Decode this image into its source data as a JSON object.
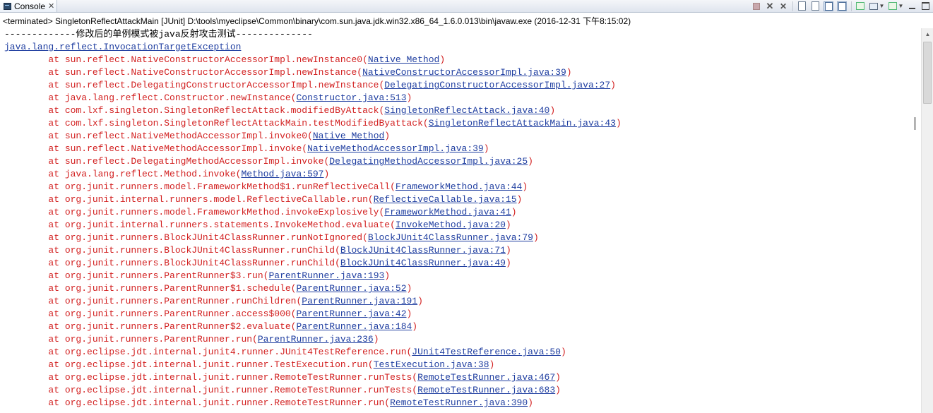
{
  "tab": {
    "label": "Console",
    "icon": "console-icon",
    "close": "✕"
  },
  "toolbar": {
    "icons": [
      "terminate-icon",
      "remove-launch-icon",
      "remove-all-terminated-icon",
      "clear-console-icon",
      "scroll-lock-icon",
      "word-wrap-icon",
      "show-console-on-output-icon",
      "pin-console-icon",
      "display-selected-console-icon",
      "open-console-icon",
      "minimize-icon",
      "maximize-icon"
    ]
  },
  "status_text": "<terminated> SingletonReflectAttackMain [JUnit] D:\\tools\\myeclipse\\Common\\binary\\com.sun.java.jdk.win32.x86_64_1.6.0.013\\bin\\javaw.exe (2016-12-31 下午8:15:02)",
  "output": {
    "separator": "-------------修改后的单例模式被java反射攻击测试--------------",
    "exception": "java.lang.reflect.InvocationTargetException",
    "frames": [
      {
        "pre": "\tat sun.reflect.NativeConstructorAccessorImpl.newInstance0(",
        "loc": "Native Method",
        "post": ")"
      },
      {
        "pre": "\tat sun.reflect.NativeConstructorAccessorImpl.newInstance(",
        "loc": "NativeConstructorAccessorImpl.java:39",
        "post": ")"
      },
      {
        "pre": "\tat sun.reflect.DelegatingConstructorAccessorImpl.newInstance(",
        "loc": "DelegatingConstructorAccessorImpl.java:27",
        "post": ")"
      },
      {
        "pre": "\tat java.lang.reflect.Constructor.newInstance(",
        "loc": "Constructor.java:513",
        "post": ")"
      },
      {
        "pre": "\tat com.lxf.singleton.SingletonReflectAttack.modifiedByAttack(",
        "loc": "SingletonReflectAttack.java:40",
        "post": ")"
      },
      {
        "pre": "\tat com.lxf.singleton.SingletonReflectAttackMain.testModifiedByattack(",
        "loc": "SingletonReflectAttackMain.java:43",
        "post": ")"
      },
      {
        "pre": "\tat sun.reflect.NativeMethodAccessorImpl.invoke0(",
        "loc": "Native Method",
        "post": ")"
      },
      {
        "pre": "\tat sun.reflect.NativeMethodAccessorImpl.invoke(",
        "loc": "NativeMethodAccessorImpl.java:39",
        "post": ")"
      },
      {
        "pre": "\tat sun.reflect.DelegatingMethodAccessorImpl.invoke(",
        "loc": "DelegatingMethodAccessorImpl.java:25",
        "post": ")"
      },
      {
        "pre": "\tat java.lang.reflect.Method.invoke(",
        "loc": "Method.java:597",
        "post": ")"
      },
      {
        "pre": "\tat org.junit.runners.model.FrameworkMethod$1.runReflectiveCall(",
        "loc": "FrameworkMethod.java:44",
        "post": ")"
      },
      {
        "pre": "\tat org.junit.internal.runners.model.ReflectiveCallable.run(",
        "loc": "ReflectiveCallable.java:15",
        "post": ")"
      },
      {
        "pre": "\tat org.junit.runners.model.FrameworkMethod.invokeExplosively(",
        "loc": "FrameworkMethod.java:41",
        "post": ")"
      },
      {
        "pre": "\tat org.junit.internal.runners.statements.InvokeMethod.evaluate(",
        "loc": "InvokeMethod.java:20",
        "post": ")"
      },
      {
        "pre": "\tat org.junit.runners.BlockJUnit4ClassRunner.runNotIgnored(",
        "loc": "BlockJUnit4ClassRunner.java:79",
        "post": ")"
      },
      {
        "pre": "\tat org.junit.runners.BlockJUnit4ClassRunner.runChild(",
        "loc": "BlockJUnit4ClassRunner.java:71",
        "post": ")"
      },
      {
        "pre": "\tat org.junit.runners.BlockJUnit4ClassRunner.runChild(",
        "loc": "BlockJUnit4ClassRunner.java:49",
        "post": ")"
      },
      {
        "pre": "\tat org.junit.runners.ParentRunner$3.run(",
        "loc": "ParentRunner.java:193",
        "post": ")"
      },
      {
        "pre": "\tat org.junit.runners.ParentRunner$1.schedule(",
        "loc": "ParentRunner.java:52",
        "post": ")"
      },
      {
        "pre": "\tat org.junit.runners.ParentRunner.runChildren(",
        "loc": "ParentRunner.java:191",
        "post": ")"
      },
      {
        "pre": "\tat org.junit.runners.ParentRunner.access$000(",
        "loc": "ParentRunner.java:42",
        "post": ")"
      },
      {
        "pre": "\tat org.junit.runners.ParentRunner$2.evaluate(",
        "loc": "ParentRunner.java:184",
        "post": ")"
      },
      {
        "pre": "\tat org.junit.runners.ParentRunner.run(",
        "loc": "ParentRunner.java:236",
        "post": ")"
      },
      {
        "pre": "\tat org.eclipse.jdt.internal.junit4.runner.JUnit4TestReference.run(",
        "loc": "JUnit4TestReference.java:50",
        "post": ")"
      },
      {
        "pre": "\tat org.eclipse.jdt.internal.junit.runner.TestExecution.run(",
        "loc": "TestExecution.java:38",
        "post": ")"
      },
      {
        "pre": "\tat org.eclipse.jdt.internal.junit.runner.RemoteTestRunner.runTests(",
        "loc": "RemoteTestRunner.java:467",
        "post": ")"
      },
      {
        "pre": "\tat org.eclipse.jdt.internal.junit.runner.RemoteTestRunner.runTests(",
        "loc": "RemoteTestRunner.java:683",
        "post": ")"
      },
      {
        "pre": "\tat org.eclipse.jdt.internal.junit.runner.RemoteTestRunner.run(",
        "loc": "RemoteTestRunner.java:390",
        "post": ")"
      }
    ]
  },
  "colors": {
    "frame_text": "#d21f1f",
    "link_text": "#1f3ea0",
    "plain_text": "#000000"
  }
}
